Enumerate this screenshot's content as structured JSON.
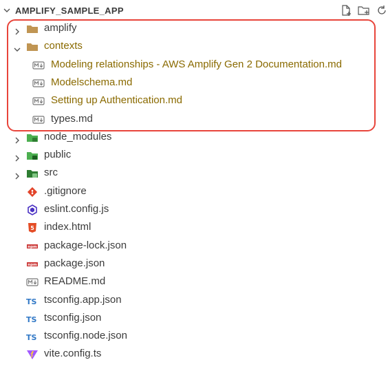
{
  "explorer": {
    "project_title": "AMPLIFY_SAMPLE_APP",
    "tree": [
      {
        "label": "amplify",
        "kind": "folder",
        "collapsed": true,
        "modified": false
      },
      {
        "label": "contexts",
        "kind": "folder",
        "collapsed": false,
        "modified": true
      },
      {
        "label": "Modeling relationships - AWS Amplify Gen 2 Documentation.md",
        "kind": "markdown",
        "modified": true
      },
      {
        "label": "Modelschema.md",
        "kind": "markdown",
        "modified": true
      },
      {
        "label": "Setting up Authentication.md",
        "kind": "markdown",
        "modified": true
      },
      {
        "label": "types.md",
        "kind": "markdown",
        "modified": false
      },
      {
        "label": "node_modules",
        "kind": "folder-node",
        "collapsed": true,
        "modified": false
      },
      {
        "label": "public",
        "kind": "folder-public",
        "collapsed": true,
        "modified": false
      },
      {
        "label": "src",
        "kind": "folder-src",
        "collapsed": true,
        "modified": false
      },
      {
        "label": ".gitignore",
        "kind": "git",
        "modified": false
      },
      {
        "label": "eslint.config.js",
        "kind": "eslint",
        "modified": false
      },
      {
        "label": "index.html",
        "kind": "html",
        "modified": false
      },
      {
        "label": "package-lock.json",
        "kind": "npm",
        "modified": false
      },
      {
        "label": "package.json",
        "kind": "npm",
        "modified": false
      },
      {
        "label": "README.md",
        "kind": "markdown",
        "modified": false
      },
      {
        "label": "tsconfig.app.json",
        "kind": "tsconfig",
        "modified": false
      },
      {
        "label": "tsconfig.json",
        "kind": "tsconfig",
        "modified": false
      },
      {
        "label": "tsconfig.node.json",
        "kind": "tsconfig",
        "modified": false
      },
      {
        "label": "vite.config.ts",
        "kind": "vite",
        "modified": false
      }
    ]
  },
  "colors": {
    "modified_text": "#8a6a00",
    "highlight_border": "#e8443a",
    "folder_brown": "#c09553",
    "folder_green": "#4caf50",
    "folder_src": "#2e7d32",
    "git_red": "#e24329",
    "eslint_purple": "#4b32c3",
    "html_orange": "#e44d26",
    "npm_red": "#cb3837",
    "ts_blue": "#3178c6",
    "vite_purple": "#a259ff"
  },
  "icons": [
    "chevron-right-icon",
    "chevron-down-icon",
    "new-file-icon",
    "new-folder-icon",
    "refresh-icon"
  ]
}
